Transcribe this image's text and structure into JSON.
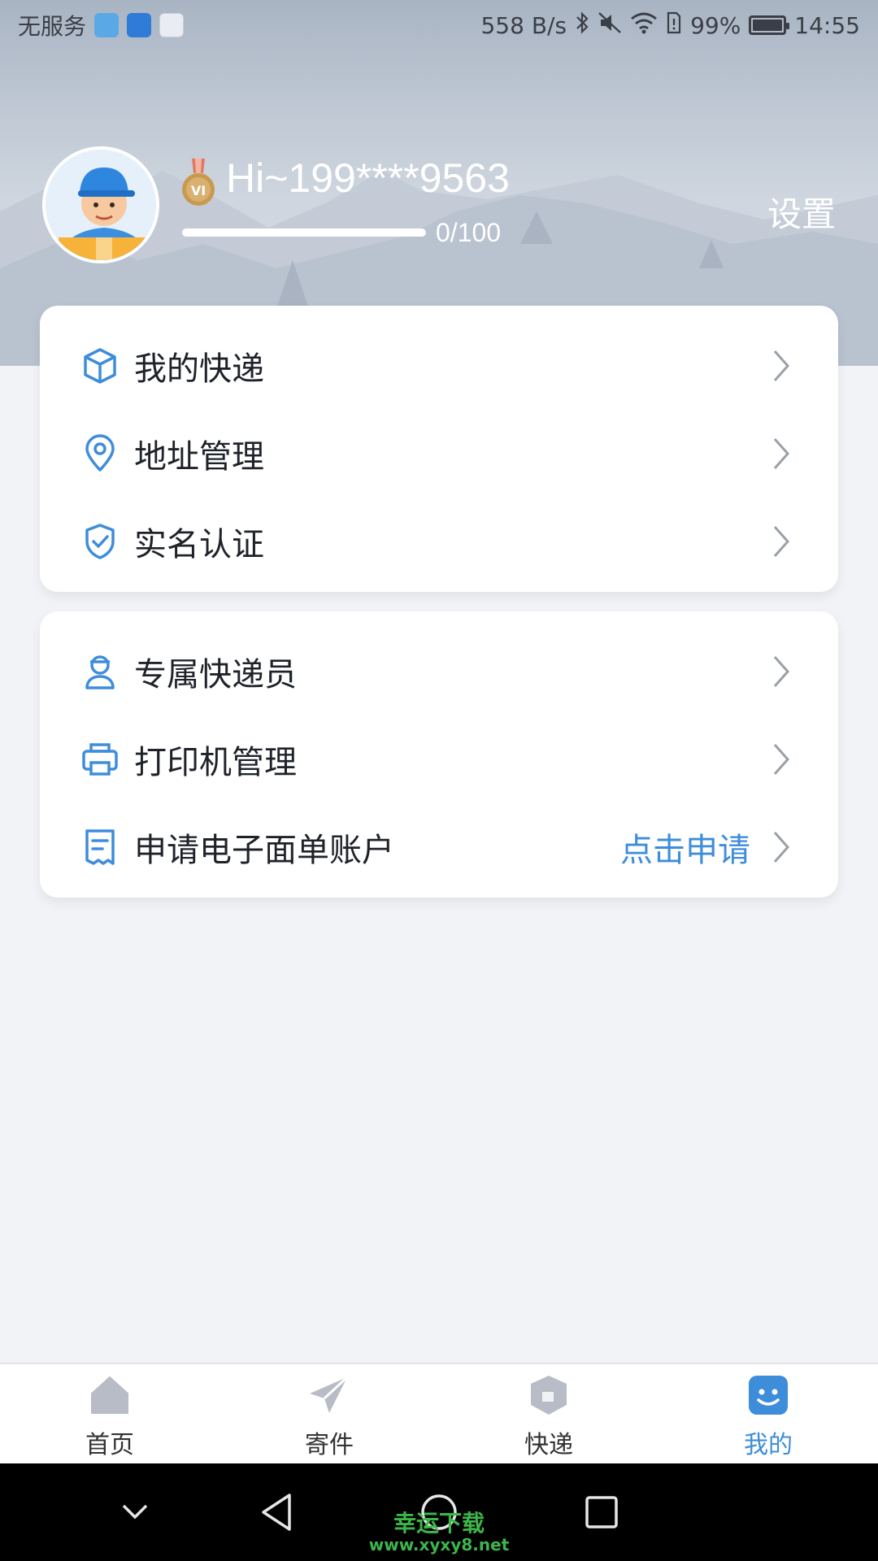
{
  "statusbar": {
    "carrier": "无服务",
    "net_speed": "558 B/s",
    "battery": "99%",
    "time": "14:55"
  },
  "profile": {
    "greeting": "Hi~199****9563",
    "progress_text": "0/100",
    "progress_value": 0,
    "progress_max": 100,
    "settings_label": "设置",
    "medal_text": "VI"
  },
  "menu_group_1": [
    {
      "label": "我的快递",
      "icon": "box-icon"
    },
    {
      "label": "地址管理",
      "icon": "location-pin-icon"
    },
    {
      "label": "实名认证",
      "icon": "shield-check-icon"
    }
  ],
  "menu_group_2": [
    {
      "label": "专属快递员",
      "icon": "courier-icon"
    },
    {
      "label": "打印机管理",
      "icon": "printer-icon"
    },
    {
      "label": "申请电子面单账户",
      "icon": "receipt-icon",
      "action": "点击申请"
    }
  ],
  "bottom_nav": [
    {
      "label": "首页",
      "icon": "home-icon",
      "active": false
    },
    {
      "label": "寄件",
      "icon": "paper-plane-icon",
      "active": false
    },
    {
      "label": "快递",
      "icon": "parcel-icon",
      "active": false
    },
    {
      "label": "我的",
      "icon": "smiley-icon",
      "active": true
    }
  ],
  "watermark": {
    "title": "幸运下载",
    "url": "www.xyxy8.net"
  },
  "colors": {
    "accent": "#3e8ddb",
    "icon_blue": "#3e8ddb",
    "nav_inactive": "#b7bcc6",
    "background": "#f2f3f7"
  }
}
